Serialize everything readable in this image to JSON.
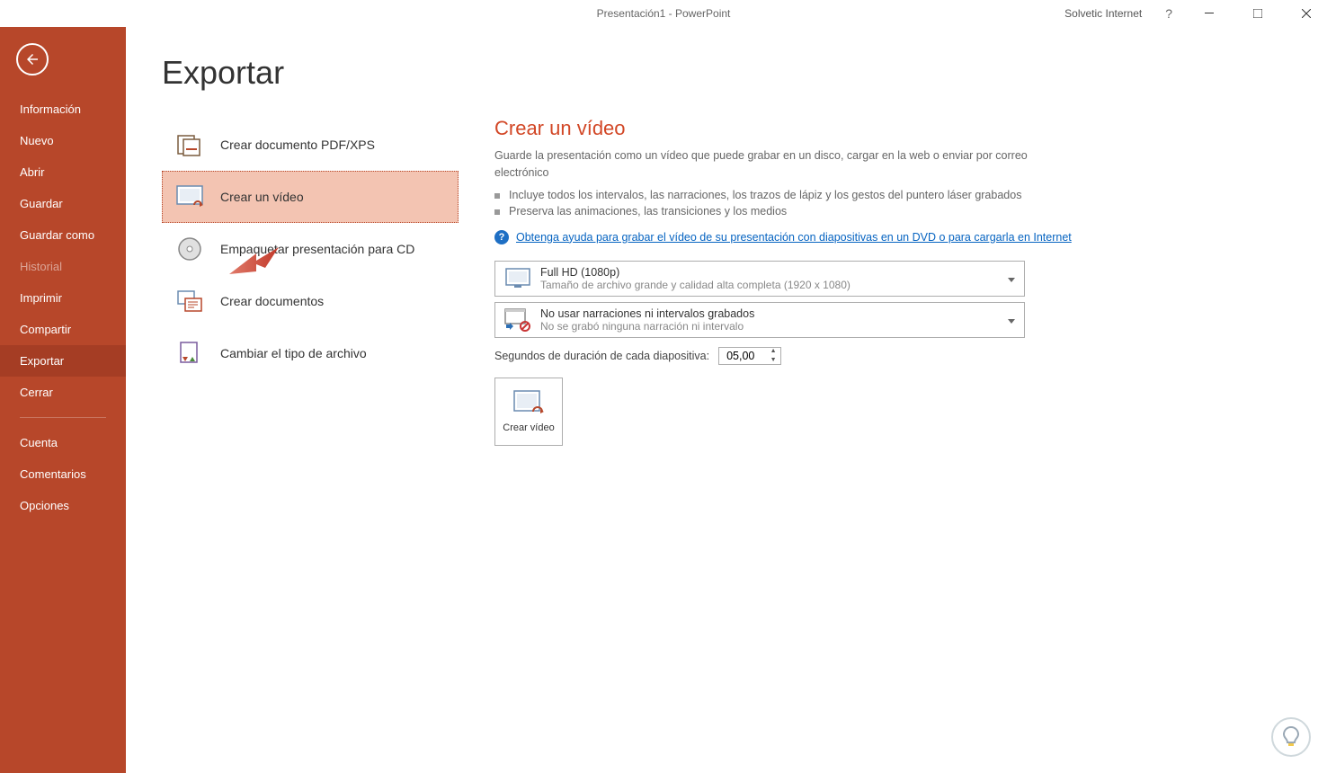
{
  "titlebar": {
    "title": "Presentación1 - PowerPoint",
    "user": "Solvetic Internet",
    "help": "?"
  },
  "sidebar": {
    "items": [
      {
        "label": "Información"
      },
      {
        "label": "Nuevo"
      },
      {
        "label": "Abrir"
      },
      {
        "label": "Guardar"
      },
      {
        "label": "Guardar como"
      },
      {
        "label": "Historial",
        "disabled": true
      },
      {
        "label": "Imprimir"
      },
      {
        "label": "Compartir"
      },
      {
        "label": "Exportar",
        "active": true
      },
      {
        "label": "Cerrar"
      }
    ],
    "footer": [
      {
        "label": "Cuenta"
      },
      {
        "label": "Comentarios"
      },
      {
        "label": "Opciones"
      }
    ]
  },
  "page": {
    "title": "Exportar"
  },
  "export_options": [
    {
      "label": "Crear documento PDF/XPS"
    },
    {
      "label": "Crear un vídeo",
      "selected": true
    },
    {
      "label": "Empaquetar presentación para CD"
    },
    {
      "label": "Crear documentos"
    },
    {
      "label": "Cambiar el tipo de archivo"
    }
  ],
  "detail": {
    "title": "Crear un vídeo",
    "desc": "Guarde la presentación como un vídeo que puede grabar en un disco, cargar en la web o enviar por correo electrónico",
    "bullets": [
      "Incluye todos los intervalos, las narraciones, los trazos de lápiz y los gestos del puntero láser grabados",
      "Preserva las animaciones, las transiciones y los medios"
    ],
    "help_link": "Obtenga ayuda para grabar el vídeo de su presentación con diapositivas en un DVD o para cargarla en Internet",
    "quality": {
      "title": "Full HD (1080p)",
      "sub": "Tamaño de archivo grande y calidad alta completa (1920 x 1080)"
    },
    "narration": {
      "title": "No usar narraciones ni intervalos grabados",
      "sub": "No se grabó ninguna narración ni intervalo"
    },
    "duration_label": "Segundos de duración de cada diapositiva:",
    "duration_value": "05,00",
    "create_button": "Crear vídeo"
  }
}
